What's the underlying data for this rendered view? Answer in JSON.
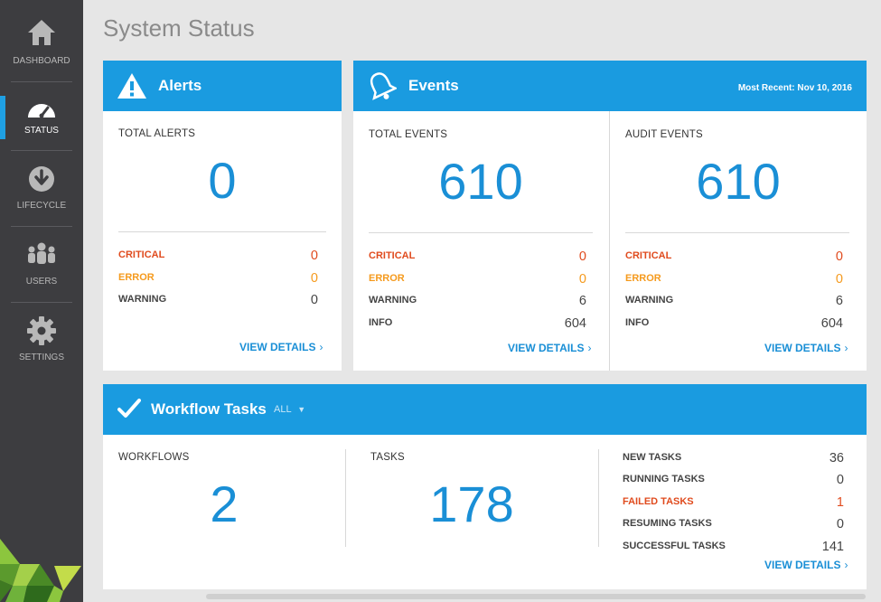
{
  "sidebar": {
    "items": [
      {
        "label": "DASHBOARD",
        "icon": "home-icon"
      },
      {
        "label": "STATUS",
        "icon": "speedometer-icon"
      },
      {
        "label": "LIFECYCLE",
        "icon": "download-circle-icon"
      },
      {
        "label": "USERS",
        "icon": "users-icon"
      },
      {
        "label": "SETTINGS",
        "icon": "gear-icon"
      }
    ]
  },
  "page": {
    "title": "System Status"
  },
  "alerts": {
    "title": "Alerts",
    "total_label": "TOTAL ALERTS",
    "total": "0",
    "rows": [
      {
        "label": "CRITICAL",
        "value": "0"
      },
      {
        "label": "ERROR",
        "value": "0"
      },
      {
        "label": "WARNING",
        "value": "0"
      }
    ],
    "view_details": "VIEW DETAILS"
  },
  "events": {
    "title": "Events",
    "most_recent": "Most Recent: Nov 10, 2016",
    "total": {
      "label": "TOTAL EVENTS",
      "value": "610",
      "rows": [
        {
          "label": "CRITICAL",
          "value": "0"
        },
        {
          "label": "ERROR",
          "value": "0"
        },
        {
          "label": "WARNING",
          "value": "6"
        },
        {
          "label": "INFO",
          "value": "604"
        }
      ],
      "view_details": "VIEW DETAILS"
    },
    "audit": {
      "label": "AUDIT EVENTS",
      "value": "610",
      "rows": [
        {
          "label": "CRITICAL",
          "value": "0"
        },
        {
          "label": "ERROR",
          "value": "0"
        },
        {
          "label": "WARNING",
          "value": "6"
        },
        {
          "label": "INFO",
          "value": "604"
        }
      ],
      "view_details": "VIEW DETAILS"
    }
  },
  "workflow": {
    "title": "Workflow Tasks",
    "filter": "ALL",
    "workflows_label": "WORKFLOWS",
    "workflows": "2",
    "tasks_label": "TASKS",
    "tasks": "178",
    "rows": [
      {
        "label": "NEW TASKS",
        "value": "36"
      },
      {
        "label": "RUNNING TASKS",
        "value": "0"
      },
      {
        "label": "FAILED TASKS",
        "value": "1"
      },
      {
        "label": "RESUMING TASKS",
        "value": "0"
      },
      {
        "label": "SUCCESSFUL TASKS",
        "value": "141"
      }
    ],
    "view_details": "VIEW DETAILS"
  },
  "colors": {
    "accent": "#1a9be0",
    "sidebar": "#3d3d40",
    "critical": "#e04b1e",
    "error": "#f59a1d"
  }
}
